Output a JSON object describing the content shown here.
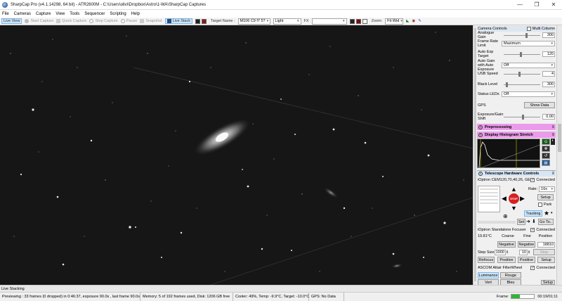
{
  "window": {
    "title": "SharpCap Pro (v4.1.14298, 64 bit) - ATR2600M - C:\\Users\\olivi\\Dropbox\\Astro\\1-WA\\SharpCap Captures"
  },
  "menu": [
    "File",
    "Cameras",
    "Capture",
    "View",
    "Tools",
    "Sequencer",
    "Scripting",
    "Help"
  ],
  "toolbar": {
    "live_view": "Live View",
    "start_capture": "Start Capture",
    "quick_capture": "Quick Capture",
    "stop_capture": "Stop Capture",
    "pause": "Pause",
    "snapshot": "Snapshot",
    "live_stack": "Live Stack",
    "target_label": "Target Name :",
    "target_value": "M106 C9 f7 5?",
    "frame_type": "Light",
    "fx_label": "FX",
    "fx_value": "",
    "zoom_label": "Zoom:",
    "zoom_value": "Fit Wid"
  },
  "panel": {
    "camera_controls_label": "Camera Controls",
    "multi_column_label": "Multi Column",
    "analogue_gain": {
      "label": "Analogue Gain",
      "value": "300"
    },
    "frame_rate_limit": {
      "label": "Frame Rate Limit",
      "value": "Maximum"
    },
    "auto_exp_target": {
      "label": "Auto Exp Target",
      "value": "120"
    },
    "auto_gain": {
      "label": "Auto Gain with Auto Exposure",
      "value": "Off"
    },
    "usb_speed": {
      "label": "USB Speed",
      "value": "4"
    },
    "black_level": {
      "label": "Black Level",
      "value": "300"
    },
    "status_leds": {
      "label": "Status LEDs",
      "value": "Off"
    },
    "gps": {
      "label": "GPS",
      "button": "Show Data"
    },
    "exposure_gain_shift": {
      "label": "Exposure/Gain Shift",
      "value": "0.00"
    },
    "preprocessing_label": "Preprocessing",
    "histogram_label": "Display Histogram Stretch",
    "telescope_label": "Telescope Hardware Controls",
    "mount_name": "iOptron CEM120,70,40,26, GE",
    "connected_label": "Connected",
    "rate_label": "Rate:",
    "rate_value": "16x",
    "setup_label": "Setup",
    "park_label": "Park",
    "tracking_label": "Tracking",
    "stop_label": "STOP",
    "set_label": "Set",
    "goto_label": "Go To..",
    "focuser_name": "iOptron Standalone Focuser",
    "focuser_temp": "19.81°C",
    "coarse_label": "Coarse",
    "fine_label": "Fine",
    "position_label": "Position",
    "negative_label": "Negative",
    "position_value": "18810",
    "step_size_label": "Step Size",
    "step_coarse": "1000",
    "step_fine": "10",
    "positive_label": "Positive",
    "refocus_label": "Refocus",
    "focuser_stop": "Stop",
    "focuser_setup": "Setup",
    "filterwheel_name": "ASCOM Altair FilterWheel",
    "filters": [
      "Luminance",
      "Rouge",
      "Vert",
      "Bleu"
    ],
    "setup_small": "Setup"
  },
  "status": {
    "live_stacking": "Live Stacking"
  },
  "bottom": {
    "previewing": "Previewing : 33 frames (0 dropped) in 0:46:37, exposure 90.0s , last frame 90.0s",
    "memory": "Memory: 5 of 192 frames used, Disk: 1206 GB free",
    "cooler": "Cooler: 49%, Temp: -9.9°C, Target: -10.0°C",
    "gps": "GPS: No Data",
    "frame_label": "Frame:",
    "frame_progress": 0.35,
    "timer": "00:19/01:11"
  },
  "colors": {
    "accent_pink": "#ea9bea",
    "progress_green": "#2fb52f",
    "stop_red": "#d62020"
  }
}
